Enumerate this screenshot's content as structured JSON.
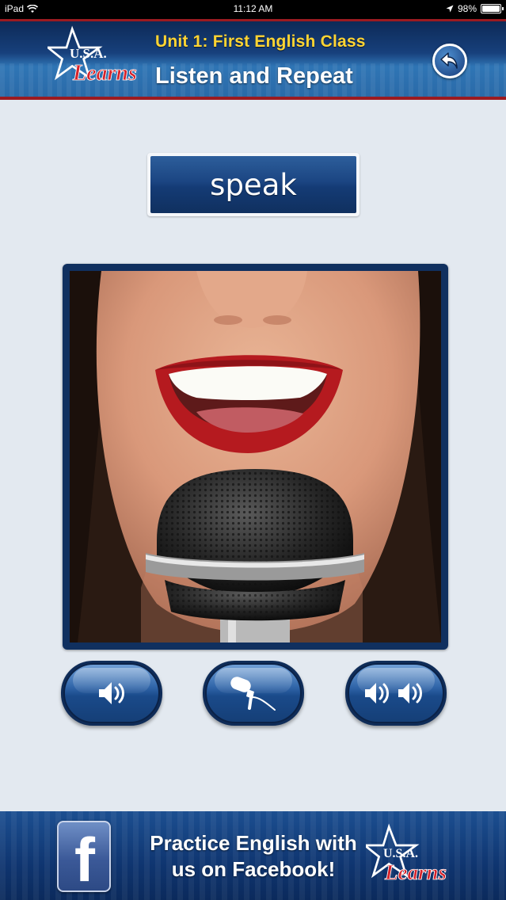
{
  "status_bar": {
    "device": "iPad",
    "time": "11:12 AM",
    "battery_text": "98%",
    "battery_level": 0.98
  },
  "header": {
    "logo": {
      "line1": "U.S.A.",
      "line2": "Learns"
    },
    "unit_title": "Unit 1: First English Class",
    "activity_title": "Listen and Repeat",
    "back_icon": "back-arrow-icon"
  },
  "word_card": {
    "word": "speak"
  },
  "photo": {
    "subject": "smiling mouth with microphone"
  },
  "controls": [
    {
      "name": "play-slow-button",
      "icon": "speaker-icon"
    },
    {
      "name": "record-button",
      "icon": "microphone-icon"
    },
    {
      "name": "playback-compare-button",
      "icon": "double-speaker-icon"
    }
  ],
  "footer": {
    "promo_line1": "Practice English with",
    "promo_line2": "us on Facebook!",
    "fb_glyph": "f",
    "logo": {
      "line1": "U.S.A.",
      "line2": "Learns"
    }
  },
  "colors": {
    "header_gold": "#ffd533",
    "navy": "#10305f",
    "accent_red": "#9b1b21",
    "facebook_blue": "#3b5998",
    "background": "#e3e9f0"
  }
}
